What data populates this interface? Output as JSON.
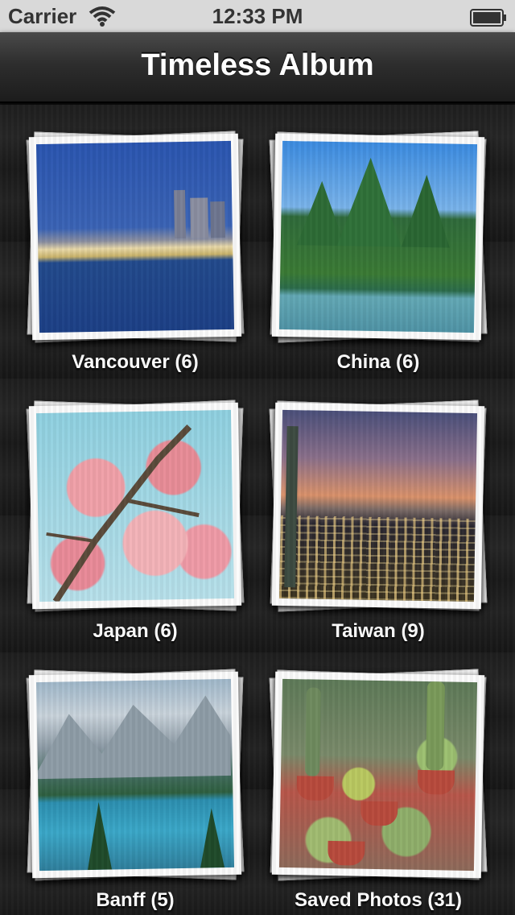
{
  "status_bar": {
    "carrier": "Carrier",
    "time": "12:33 PM",
    "wifi_icon": "wifi-icon",
    "battery_icon": "battery-icon"
  },
  "nav": {
    "title": "Timeless Album"
  },
  "albums": [
    {
      "label": "Vancouver (6)"
    },
    {
      "label": "China (6)"
    },
    {
      "label": "Japan (6)"
    },
    {
      "label": "Taiwan (9)"
    },
    {
      "label": "Banff (5)"
    },
    {
      "label": "Saved Photos (31)"
    }
  ],
  "colors": {
    "status_bar_bg": "#d9d9d9",
    "nav_bar_bg": "#2e2e2e",
    "background": "#1a1a1a",
    "label_text": "#ffffff"
  }
}
